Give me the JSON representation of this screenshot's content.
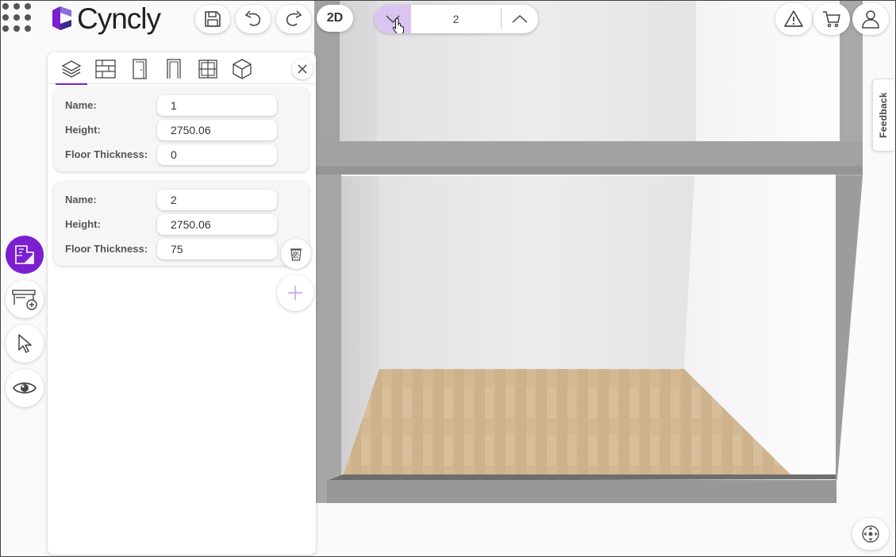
{
  "app": {
    "brand": "Cyncly",
    "brand_color": "#7b1fd1",
    "accent_light": "#dcc4f0"
  },
  "toolbar": {
    "apps_icon": "grid-dots-icon",
    "save_icon": "floppy-disk-icon",
    "undo_icon": "undo-arrow-icon",
    "redo_icon": "redo-arrow-icon",
    "view_mode_label": "2D"
  },
  "floor_selector": {
    "current": "2",
    "down_icon": "chevron-down-icon",
    "up_icon": "chevron-up-icon"
  },
  "top_right": {
    "warning_icon": "warning-triangle-icon",
    "cart_icon": "shopping-cart-icon",
    "user_icon": "user-profile-icon"
  },
  "feedback": {
    "label": "Feedback"
  },
  "side_tools": [
    {
      "icon": "floor-plan-icon",
      "active": true
    },
    {
      "icon": "add-cabinet-icon",
      "active": false
    },
    {
      "icon": "cursor-pointer-icon",
      "active": false
    },
    {
      "icon": "eye-icon",
      "active": false
    }
  ],
  "panel": {
    "tabs": [
      "layers-icon",
      "wall-icon",
      "door-icon",
      "opening-icon",
      "window-icon",
      "cube-icon"
    ],
    "close_icon": "close-icon",
    "floors": [
      {
        "name_label": "Name:",
        "name": "1",
        "height_label": "Height:",
        "height": "2750.06",
        "thickness_label": "Floor Thickness:",
        "thickness": "0"
      },
      {
        "name_label": "Name:",
        "name": "2",
        "height_label": "Height:",
        "height": "2750.06",
        "thickness_label": "Floor Thickness:",
        "thickness": "75"
      }
    ],
    "delete_icon": "trash-icon",
    "add_icon": "plus-icon"
  },
  "nav_icon": "orbit-navigation-icon"
}
